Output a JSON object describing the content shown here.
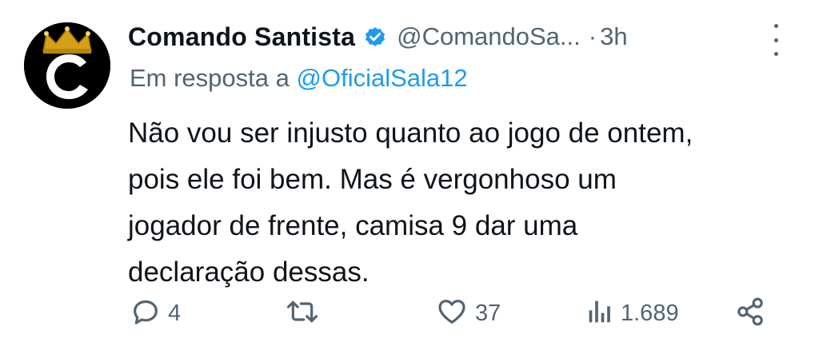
{
  "author": {
    "display_name": "Comando Santista",
    "handle": "@ComandoSa...",
    "separator": "·",
    "time": "3h",
    "avatar_icon": "crowned-c-logo",
    "verified_icon": "verified-badge-icon"
  },
  "reply": {
    "prefix": "Em resposta a",
    "mention": "@OficialSala12"
  },
  "tweet": {
    "lines": [
      "Não vou ser injusto quanto ao jogo de ontem,",
      "pois ele foi bem. Mas é vergonhoso um",
      "jogador de frente, camisa 9 dar uma",
      "declaração dessas."
    ]
  },
  "actions": {
    "replies": "4",
    "retweets": "",
    "likes": "37",
    "views": "1.689"
  },
  "colors": {
    "text": "#0f1419",
    "secondary": "#536471",
    "accent": "#1d9bf0",
    "crown": "#d4a017"
  }
}
